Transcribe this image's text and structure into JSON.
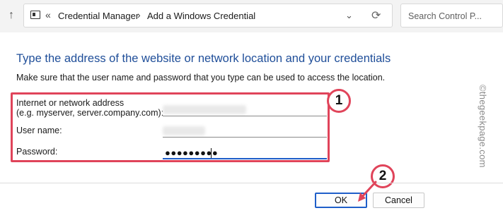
{
  "nav": {
    "breadcrumb_1": "Credential Manager",
    "breadcrumb_2": "Add a Windows Credential",
    "search_placeholder": "Search Control P..."
  },
  "main": {
    "heading": "Type the address of the website or network location and your credentials",
    "instructions": "Make sure that the user name and password that you type can be used to access the location.",
    "address_label_line1": "Internet or network address",
    "address_label_line2": "(e.g. myserver, server.company.com):",
    "username_label": "User name:",
    "password_label": "Password:",
    "password_value": "●●●●●●●●●"
  },
  "annotations": {
    "badge_1": "1",
    "badge_2": "2",
    "accent_color": "#e0445a"
  },
  "watermark": "©thegeekpage.com",
  "buttons": {
    "ok": "OK",
    "cancel": "Cancel"
  }
}
